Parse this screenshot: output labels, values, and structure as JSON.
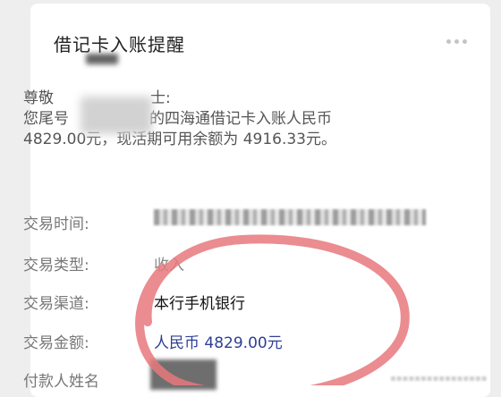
{
  "notification": {
    "title": "借记卡入账提醒",
    "more_icon": "more-dots-icon",
    "body_lines": [
      "尊敬",
      "您尾号",
      "4829.00元，现活期可用余额为 4916.33元。"
    ],
    "body_line1_suffix": "士:",
    "body_line2_suffix": "的四海通借记卡入账人民币"
  },
  "details": [
    {
      "label": "交易时间:",
      "value": ""
    },
    {
      "label": "交易类型:",
      "value": "收入"
    },
    {
      "label": "交易渠道:",
      "value": "本行手机银行"
    },
    {
      "label": "交易金额:",
      "value": "人民币 4829.00元"
    },
    {
      "label": "付款人姓名",
      "value": ""
    }
  ],
  "colors": {
    "amount": "#2d3f96",
    "annotation_circle": "#e8787c"
  }
}
